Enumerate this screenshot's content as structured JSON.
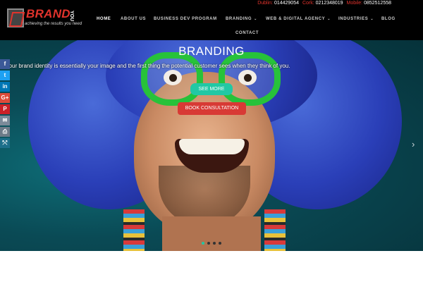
{
  "header": {
    "logo": {
      "brand": "BRAND",
      "you": "YOU",
      "tagline": "achieving the results you need"
    },
    "contacts": [
      {
        "label": "Dublin:",
        "number": "014429054"
      },
      {
        "label": "Cork:",
        "number": "0212348019"
      },
      {
        "label": "Mobile:",
        "number": "0852512558"
      }
    ],
    "nav": {
      "home": "HOME",
      "about": "ABOUT US",
      "business": "BUSINESS DEV PROGRAM",
      "branding": "BRANDING",
      "web": "WEB & DIGITAL AGENCY",
      "industries": "INDUSTRIES",
      "blog": "BLOG",
      "contact": "CONTACT",
      "chevron": "⌄"
    }
  },
  "hero": {
    "title": "BRANDING",
    "text": "our brand identity is essentially your image and the first thing the potential customer sees when they think of you.",
    "see_more": "SEE MORE",
    "book": "BOOK CONSULTATION",
    "prev_arrow": "‹",
    "next_arrow": "›",
    "slides": 4,
    "active_slide": 1
  },
  "social": [
    {
      "icon": "facebook-icon",
      "glyph": "f",
      "color": "#3b5998"
    },
    {
      "icon": "twitter-icon",
      "glyph": "t",
      "color": "#1da1f2"
    },
    {
      "icon": "linkedin-icon",
      "glyph": "in",
      "color": "#0077b5"
    },
    {
      "icon": "google-plus-icon",
      "glyph": "G+",
      "color": "#dd4b39"
    },
    {
      "icon": "pinterest-icon",
      "glyph": "P",
      "color": "#cb2027"
    },
    {
      "icon": "email-icon",
      "glyph": "✉",
      "color": "#7b8a99"
    },
    {
      "icon": "print-icon",
      "glyph": "⎙",
      "color": "#6d7b88"
    },
    {
      "icon": "share-icon",
      "glyph": "⤲",
      "color": "#1d6f8a"
    }
  ]
}
